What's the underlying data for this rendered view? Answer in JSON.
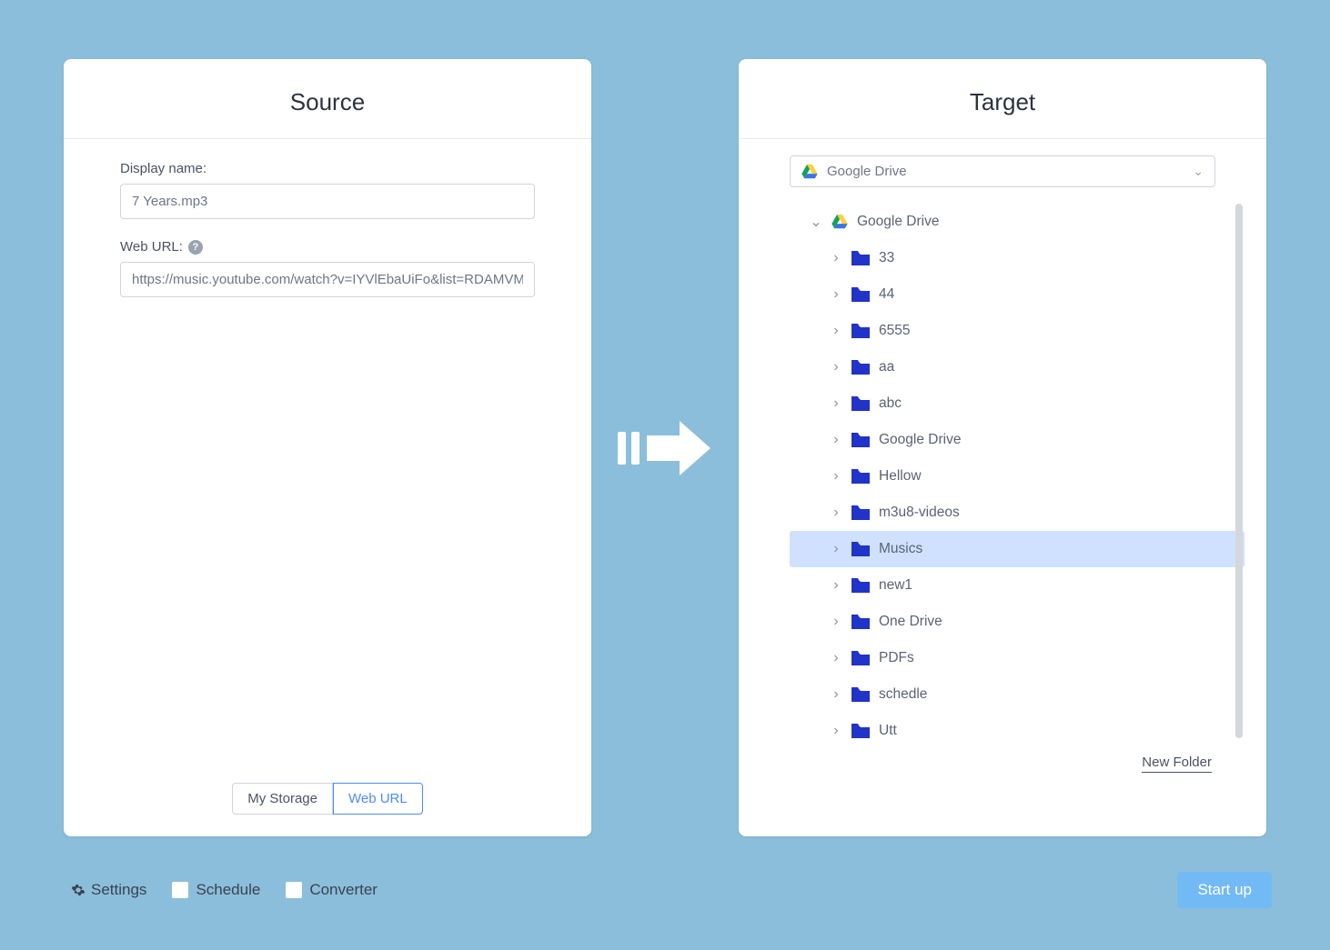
{
  "source": {
    "title": "Source",
    "display_name_label": "Display name:",
    "display_name_value": "7 Years.mp3",
    "url_label": "Web URL:",
    "url_value": "https://music.youtube.com/watch?v=IYVlEbaUiFo&list=RDAMVM(",
    "tabs": {
      "my_storage": "My Storage",
      "web_url": "Web URL"
    }
  },
  "target": {
    "title": "Target",
    "selected_drive": "Google Drive",
    "root_label": "Google Drive",
    "folders": [
      "33",
      "44",
      "6555",
      "aa",
      "abc",
      "Google Drive",
      "Hellow",
      "m3u8-videos",
      "Musics",
      "new1",
      "One Drive",
      "PDFs",
      "schedle",
      "Utt"
    ],
    "selected_folder": "Musics",
    "new_folder_label": "New Folder"
  },
  "footer": {
    "settings": "Settings",
    "schedule": "Schedule",
    "converter": "Converter",
    "start": "Start up"
  }
}
